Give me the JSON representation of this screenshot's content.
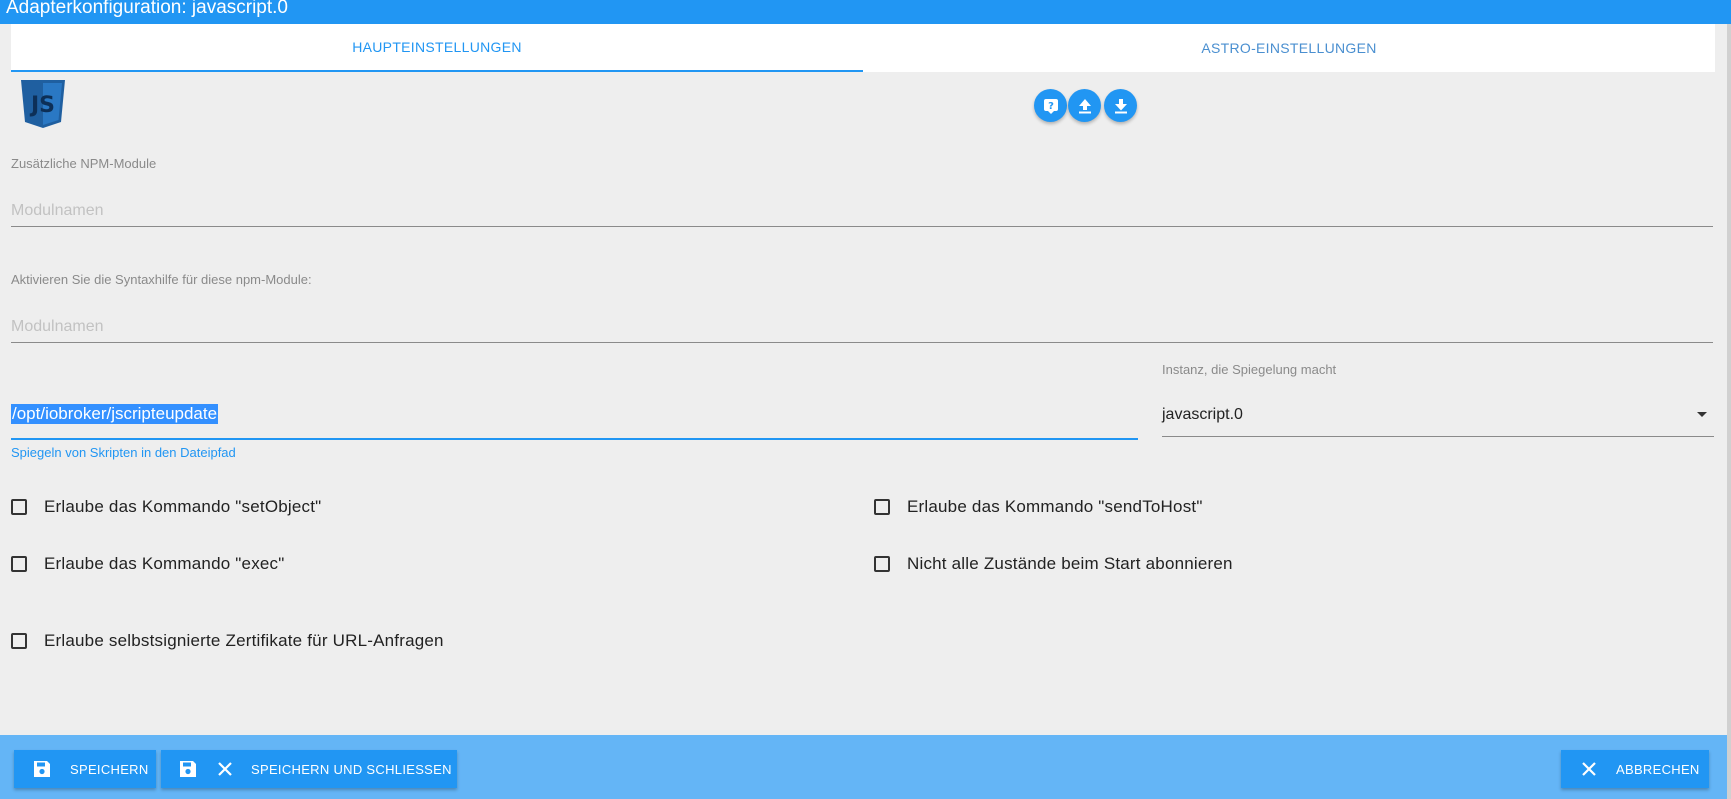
{
  "title": "Adapterkonfiguration: javascript.0",
  "tabs": [
    {
      "label": "Haupteinstellungen",
      "active": true
    },
    {
      "label": "Astro-Einstellungen",
      "active": false
    }
  ],
  "logo": {
    "text": "JS",
    "icon": "javascript-logo"
  },
  "toolbar_icons": [
    "help-icon",
    "upload-icon",
    "download-icon"
  ],
  "npm": {
    "label": "Zusätzliche NPM-Module",
    "placeholder": "Modulnamen"
  },
  "syntax": {
    "label": "Aktivieren Sie die Syntaxhilfe für diese npm-Module:",
    "placeholder": "Modulnamen"
  },
  "mirror": {
    "value": "/opt/iobroker/jscripteupdate",
    "helper": "Spiegeln von Skripten in den Dateipfad"
  },
  "instance": {
    "label": "Instanz, die Spiegelung macht",
    "value": "javascript.0"
  },
  "checkboxes": [
    {
      "label": "Erlaube das Kommando \"setObject\"",
      "checked": false
    },
    {
      "label": "Erlaube das Kommando \"sendToHost\"",
      "checked": false
    },
    {
      "label": "Erlaube das Kommando \"exec\"",
      "checked": false
    },
    {
      "label": "Nicht alle Zustände beim Start abonnieren",
      "checked": false
    },
    {
      "label": "Erlaube selbstsignierte Zertifikate für URL-Anfragen",
      "checked": false
    }
  ],
  "buttons": {
    "save": "Speichern",
    "save_close": "Speichern und schließen",
    "cancel": "Abbrechen"
  },
  "colors": {
    "primary": "#2196f3",
    "bottom_bar": "#64b5f6",
    "background": "#eeeeee"
  }
}
